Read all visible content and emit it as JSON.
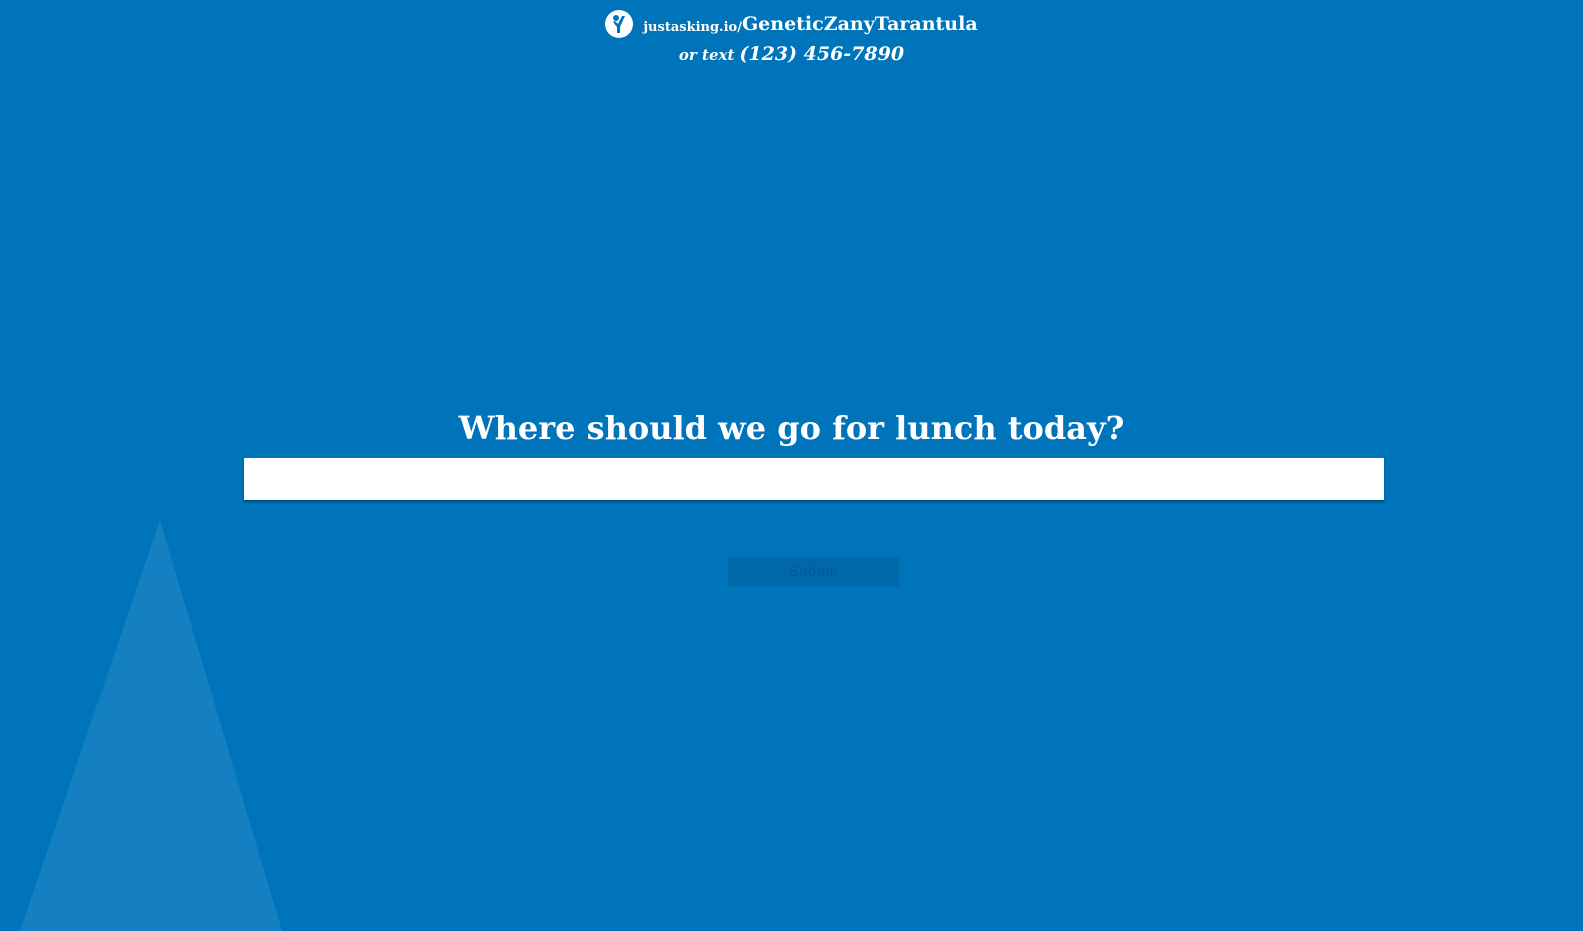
{
  "header": {
    "logo_icon": "person-raising-hand-icon",
    "url_prefix": "justasking.io/",
    "url_slug": "GeneticZanyTarantula",
    "text_prefix": "or text",
    "phone": "(123) 456-7890"
  },
  "question": {
    "title": "Where should we go for lunch today?"
  },
  "answer": {
    "value": "",
    "placeholder": ""
  },
  "submit": {
    "label": "Submit"
  },
  "colors": {
    "background": "#0074ba",
    "text": "#ffffff",
    "submit_bg": "#0068a8",
    "submit_text": "#005a93",
    "decor_triangle": "#1a80c0"
  }
}
